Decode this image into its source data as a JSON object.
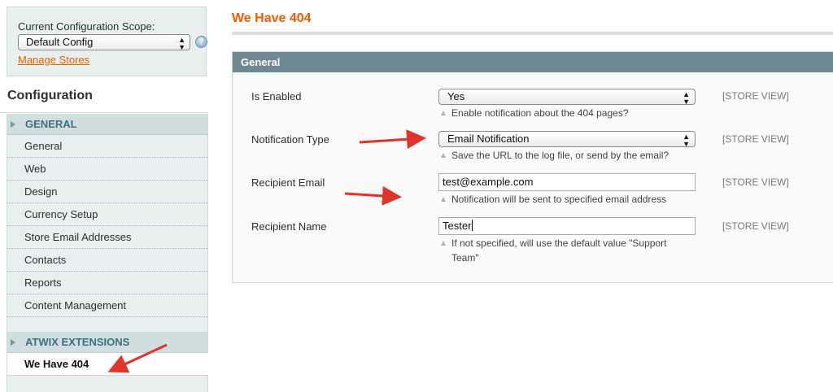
{
  "scope": {
    "label": "Current Configuration Scope:",
    "selected": "Default Config",
    "manage_link": "Manage Stores"
  },
  "sidebar": {
    "title": "Configuration",
    "sections": [
      {
        "heading": "GENERAL",
        "items": [
          "General",
          "Web",
          "Design",
          "Currency Setup",
          "Store Email Addresses",
          "Contacts",
          "Reports",
          "Content Management"
        ]
      },
      {
        "heading": "ATWIX EXTENSIONS",
        "items": [
          "We Have 404"
        ]
      }
    ]
  },
  "main": {
    "page_title": "We Have 404",
    "fieldset_title": "General",
    "fields": [
      {
        "label": "Is Enabled",
        "value": "Yes",
        "note": "Enable notification about the 404 pages?",
        "scope": "[STORE VIEW]"
      },
      {
        "label": "Notification Type",
        "value": "Email Notification",
        "note": "Save the URL to the log file, or send by the email?",
        "scope": "[STORE VIEW]"
      },
      {
        "label": "Recipient Email",
        "value": "test@example.com",
        "note": "Notification will be sent to specified email address",
        "scope": "[STORE VIEW]"
      },
      {
        "label": "Recipient Name",
        "value": "Tester",
        "note": "If not specified, will use the default value \"Support Team\"",
        "scope": "[STORE VIEW]"
      }
    ]
  },
  "colors": {
    "accent_orange": "#eb5e00",
    "fieldset_header": "#6f8992",
    "sidebar_bg": "#e7efef",
    "annotation_arrow": "#e0342b"
  },
  "icons": {
    "help": "help-icon",
    "select_arrows": "chevron-up-down-icon",
    "note": "triangle-up-icon",
    "section": "triangle-right-icon"
  }
}
